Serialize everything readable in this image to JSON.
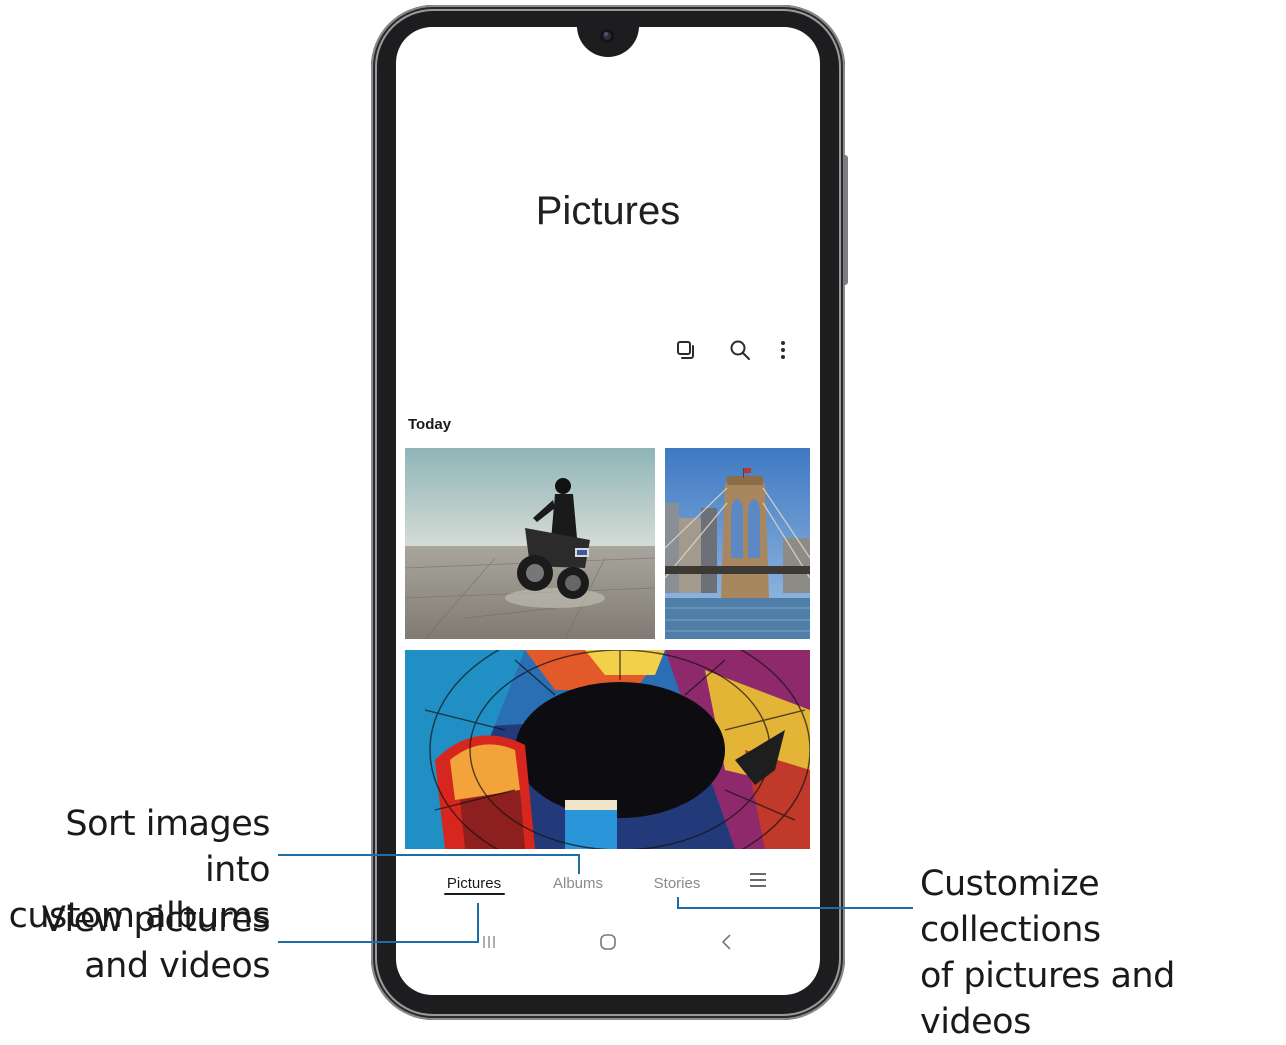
{
  "screen": {
    "title": "Pictures",
    "toolbar": {
      "icons": [
        "select-multiple-icon",
        "search-icon",
        "more-options-icon"
      ]
    },
    "section": {
      "label": "Today",
      "photos": [
        {
          "name": "photo-motorcycle",
          "description_icon": "image-thumbnail"
        },
        {
          "name": "photo-bridge",
          "description_icon": "image-thumbnail"
        },
        {
          "name": "photo-stained-glass-dome",
          "description_icon": "image-thumbnail"
        }
      ]
    },
    "tabs": [
      {
        "label": "Pictures",
        "active": true
      },
      {
        "label": "Albums",
        "active": false
      },
      {
        "label": "Stories",
        "active": false
      }
    ],
    "menu_icon": "hamburger-menu-icon",
    "nav_bar": [
      "recent-apps-icon",
      "home-icon",
      "back-icon"
    ]
  },
  "callouts": {
    "albums": {
      "line1": "Sort images into",
      "line2": "custom albums"
    },
    "pictures": {
      "line1": "View pictures",
      "line2": "and videos"
    },
    "stories": {
      "line1": "Customize collections",
      "line2": "of pictures and videos"
    }
  },
  "colors": {
    "leader_line": "#1b6fa8",
    "phone_frame": "#1d1d1f",
    "active_tab": "#1a1a1a",
    "inactive_tab": "#8a8a8a"
  }
}
